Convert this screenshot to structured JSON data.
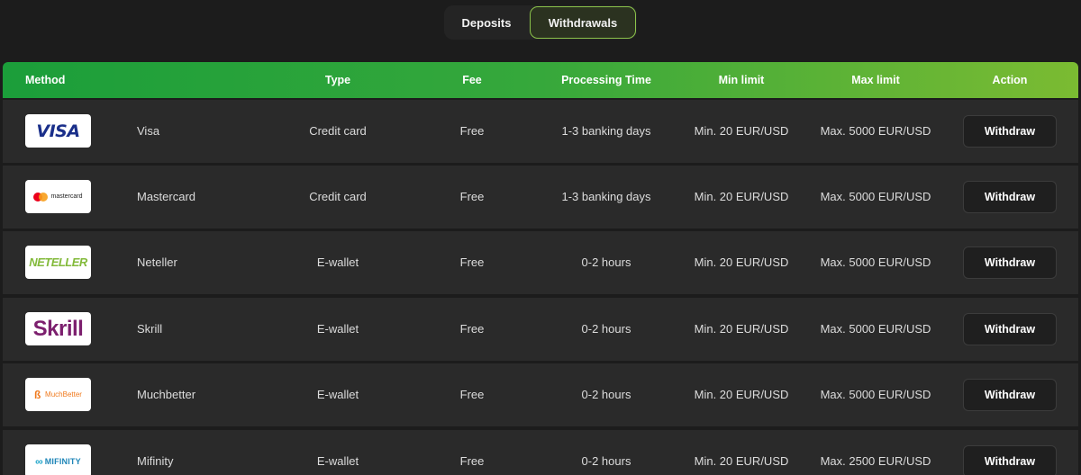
{
  "tabs": {
    "deposits": "Deposits",
    "withdrawals": "Withdrawals",
    "active": "withdrawals"
  },
  "table": {
    "headers": {
      "method": "Method",
      "type": "Type",
      "fee": "Fee",
      "processing_time": "Processing Time",
      "min_limit": "Min limit",
      "max_limit": "Max limit",
      "action": "Action"
    },
    "rows": [
      {
        "logo_text": "VISA",
        "method": "Visa",
        "type": "Credit card",
        "fee": "Free",
        "processing_time": "1-3 banking days",
        "min_limit": "Min. 20 EUR/USD",
        "max_limit": "Max. 5000 EUR/USD",
        "action": "Withdraw"
      },
      {
        "logo_text": "mastercard",
        "method": "Mastercard",
        "type": "Credit card",
        "fee": "Free",
        "processing_time": "1-3 banking days",
        "min_limit": "Min. 20 EUR/USD",
        "max_limit": "Max. 5000 EUR/USD",
        "action": "Withdraw"
      },
      {
        "logo_text": "NETELLER",
        "method": "Neteller",
        "type": "E-wallet",
        "fee": "Free",
        "processing_time": "0-2 hours",
        "min_limit": "Min. 20 EUR/USD",
        "max_limit": "Max. 5000 EUR/USD",
        "action": "Withdraw"
      },
      {
        "logo_text": "Skrill",
        "method": "Skrill",
        "type": "E-wallet",
        "fee": "Free",
        "processing_time": "0-2 hours",
        "min_limit": "Min. 20 EUR/USD",
        "max_limit": "Max. 5000 EUR/USD",
        "action": "Withdraw"
      },
      {
        "logo_text": "MuchBetter",
        "method": "Muchbetter",
        "type": "E-wallet",
        "fee": "Free",
        "processing_time": "0-2 hours",
        "min_limit": "Min. 20 EUR/USD",
        "max_limit": "Max. 5000 EUR/USD",
        "action": "Withdraw"
      },
      {
        "logo_text": "MIFINITY",
        "method": "Mifinity",
        "type": "E-wallet",
        "fee": "Free",
        "processing_time": "0-2 hours",
        "min_limit": "Min. 20 EUR/USD",
        "max_limit": "Max. 2500 EUR/USD",
        "action": "Withdraw"
      }
    ]
  },
  "colors": {
    "header_gradient_start": "#1b9e3a",
    "header_gradient_end": "#7bbb32",
    "active_tab_border": "#8bc34a",
    "row_background": "#2a2a2a",
    "page_background": "#1c1c1c"
  }
}
